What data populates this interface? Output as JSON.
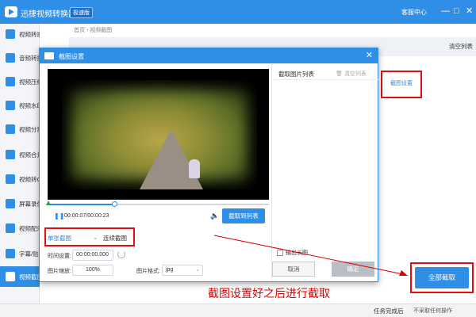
{
  "app": {
    "title": "迅捷视频转换器",
    "badge": "极速版",
    "service": "客服中心"
  },
  "window_controls": [
    "—",
    "□",
    "✕"
  ],
  "sidebar": {
    "items": [
      {
        "label": "视频转换",
        "icon": "convert-icon"
      },
      {
        "label": "音频转换",
        "icon": "audio-icon"
      },
      {
        "label": "视频压缩",
        "icon": "compress-icon"
      },
      {
        "label": "视频水印",
        "icon": "watermark-icon"
      },
      {
        "label": "视频分割",
        "icon": "split-icon"
      },
      {
        "label": "视频合并",
        "icon": "merge-icon"
      },
      {
        "label": "视频转GIF",
        "icon": "gif-icon"
      },
      {
        "label": "屏幕录像",
        "icon": "record-icon"
      },
      {
        "label": "视频配乐",
        "icon": "music-icon"
      },
      {
        "label": "字幕/贴图",
        "icon": "subtitle-icon"
      },
      {
        "label": "视频截图",
        "icon": "screenshot-icon",
        "active": true
      }
    ]
  },
  "main": {
    "breadcrumb": "首页 › 视频截图",
    "clear_list": "清空列表",
    "capture_settings": "截图设置",
    "start_all": "全部截取"
  },
  "status": {
    "done_label": "任务完成后",
    "no_action": "不采取任何操作"
  },
  "dialog": {
    "title": "截图设置",
    "time_display": "00:00:07/00:00:23",
    "playback_progress": 0.3,
    "capture_button": "截取到列表",
    "tab_single": "单张截图",
    "tab_continuous": "连续截图",
    "time_label": "时间设置:",
    "time_value": "00:00:00.000",
    "scale_label": "图片缩放:",
    "scale_value": "100%",
    "format_label": "图片格式:",
    "format_value": "jpg",
    "list_title": "截取图片列表",
    "list_clear": "清空列表",
    "export_label": "输出长图",
    "cancel": "取消",
    "confirm": "确定"
  },
  "annotation": {
    "caption": "截图设置好之后进行截取",
    "color": "#e00000"
  },
  "colors": {
    "accent": "#2f8fe6",
    "highlight": "#e50d0d"
  }
}
